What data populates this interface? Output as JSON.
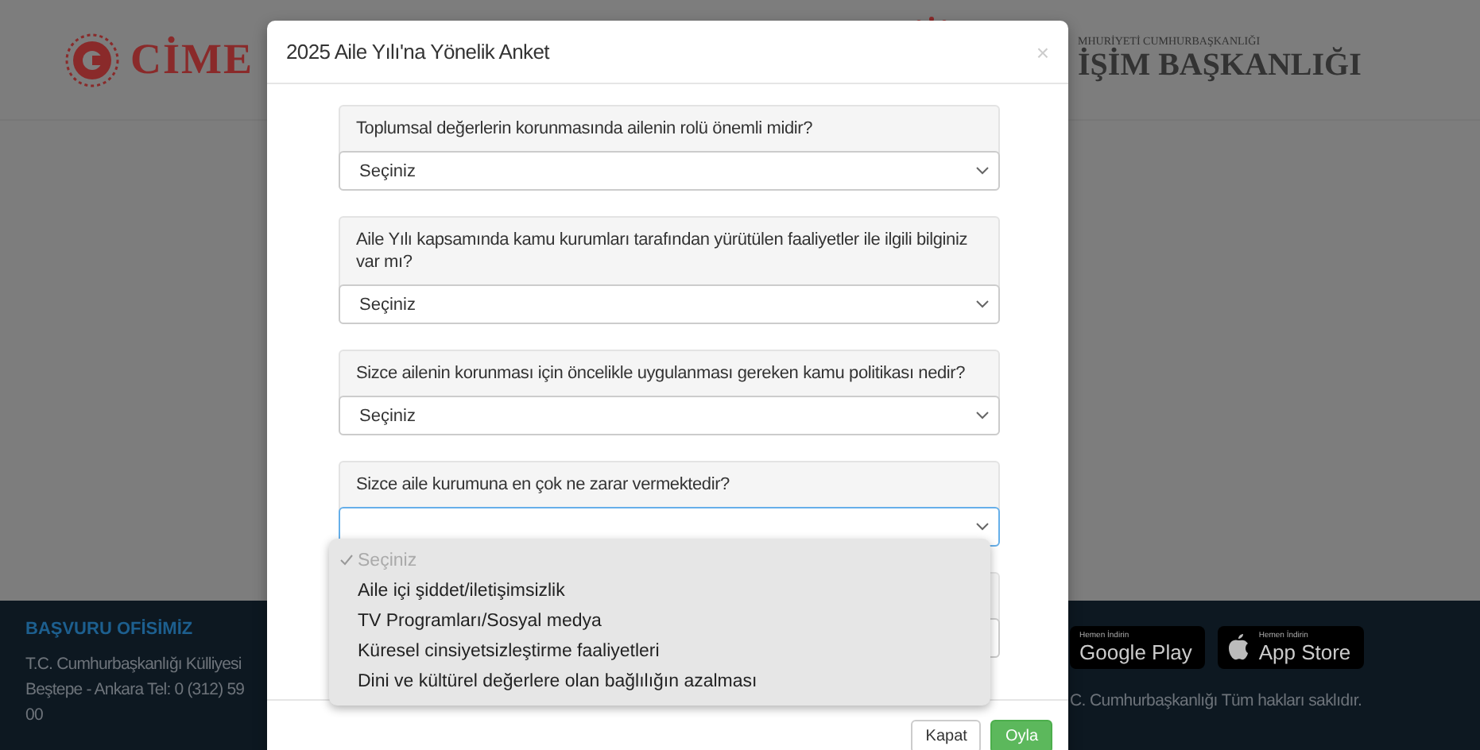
{
  "background": {
    "header": {
      "logo_text": "CİME",
      "right_small": "MHURİYETİ CUMHURBAŞKANLIĞI",
      "right_large": "İŞİM BAŞKANLIĞI"
    },
    "footer": {
      "heading": "BAŞVURU OFİSİMİZ",
      "address_lines": [
        "T.C. Cumhurbaşkanlığı Külliyesi",
        "Beştepe - Ankara Tel: 0 (312) 59",
        "00"
      ],
      "store_badges": [
        {
          "kind": "google",
          "small": "Hemen İndirin",
          "large": "Google Play"
        },
        {
          "kind": "apple",
          "small": "Hemen İndirin",
          "large": "App Store"
        }
      ],
      "copyright": "C. Cumhurbaşkanlığı Tüm hakları saklıdır."
    }
  },
  "modal": {
    "title": "2025 Aile Yılı'na Yönelik Anket",
    "close": "×",
    "questions": [
      {
        "text": "Toplumsal değerlerin korunmasında ailenin rolü önemli midir?",
        "value": "Seçiniz",
        "open": false
      },
      {
        "text": "Aile Yılı kapsamında kamu kurumları tarafından yürütülen faaliyetler ile ilgili bilginiz var mı?",
        "value": "Seçiniz",
        "open": false
      },
      {
        "text": "Sizce ailenin korunması için öncelikle uygulanması gereken kamu politikası nedir?",
        "value": "Seçiniz",
        "open": false
      },
      {
        "text": "Sizce aile kurumuna en çok ne zarar vermektedir?",
        "open": true,
        "options": [
          {
            "label": "Seçiniz",
            "selected": true
          },
          {
            "label": "Aile içi şiddet/iletişimsizlik",
            "selected": false
          },
          {
            "label": "TV Programları/Sosyal medya",
            "selected": false
          },
          {
            "label": "Küresel cinsiyetsizleştirme faaliyetleri",
            "selected": false
          },
          {
            "label": "Dini ve kültürel değerlere olan bağlılığın azalması",
            "selected": false
          }
        ]
      }
    ],
    "buttons": [
      {
        "kind": "default",
        "label": "Kapat"
      },
      {
        "kind": "primary",
        "label": "Oyla"
      }
    ]
  }
}
